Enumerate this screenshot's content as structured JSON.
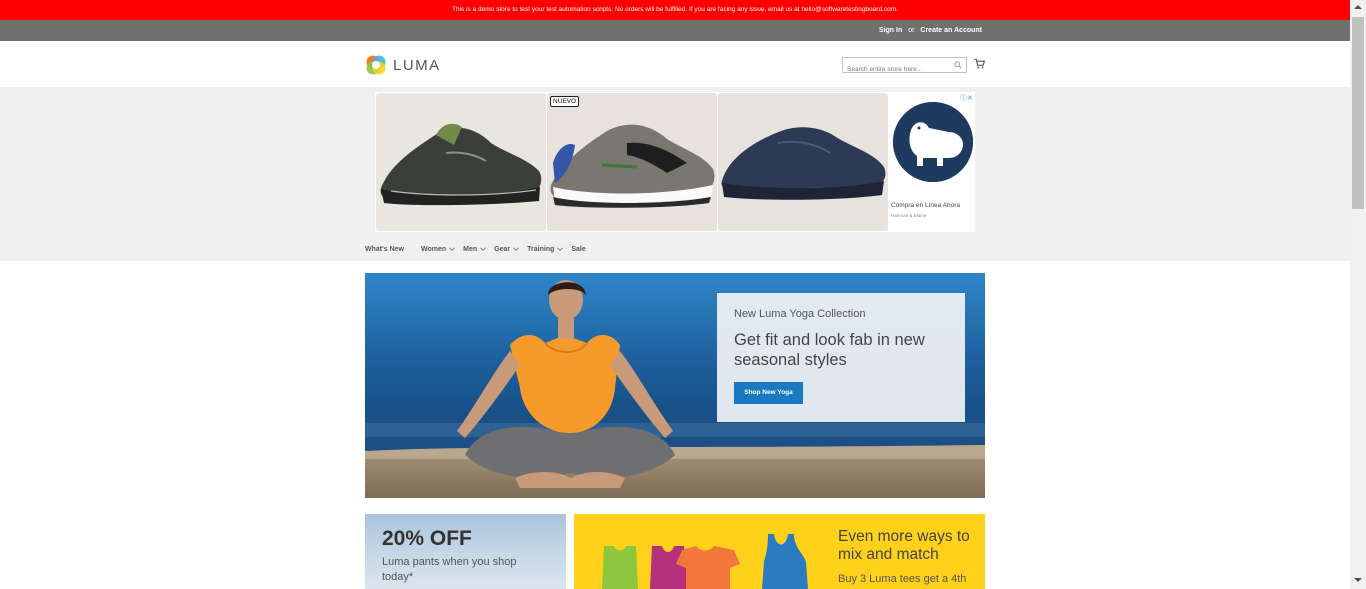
{
  "demo_notice": "This is a demo store to test your test automation scripts. No orders will be fulfilled. If you are facing any issue, email us at hello@softwaretestingboard.com.",
  "top_links": {
    "sign_in": "Sign In",
    "or": "or",
    "create_account": "Create an Account"
  },
  "header": {
    "logo_text": "LUMA",
    "search_placeholder": "Search entire store here...",
    "search_icon": "search-icon",
    "cart_icon": "cart-icon"
  },
  "ad": {
    "badge": "NUEVO",
    "caption": "Compra en Línea Ahora",
    "sub_caption": "Harmont & Blaine",
    "choices_icon": "ad-choices-icon"
  },
  "nav": {
    "items": [
      {
        "label": "What's New",
        "has_dropdown": false
      },
      {
        "label": "Women",
        "has_dropdown": true
      },
      {
        "label": "Men",
        "has_dropdown": true
      },
      {
        "label": "Gear",
        "has_dropdown": true
      },
      {
        "label": "Training",
        "has_dropdown": true
      },
      {
        "label": "Sale",
        "has_dropdown": false
      }
    ]
  },
  "hero": {
    "kicker": "New Luma Yoga Collection",
    "title": "Get fit and look fab in new seasonal styles",
    "button": "Shop New Yoga"
  },
  "promo_left": {
    "headline": "20% OFF",
    "sub": "Luma pants when you shop today*"
  },
  "promo_right": {
    "headline": "Even more ways to mix and match",
    "sub": "Buy 3 Luma tees get a 4th"
  },
  "colors": {
    "demo_bar": "#ff0000",
    "top_bar": "#6e716e",
    "primary_button": "#1979c3",
    "promo_yellow": "#ffd11b"
  }
}
